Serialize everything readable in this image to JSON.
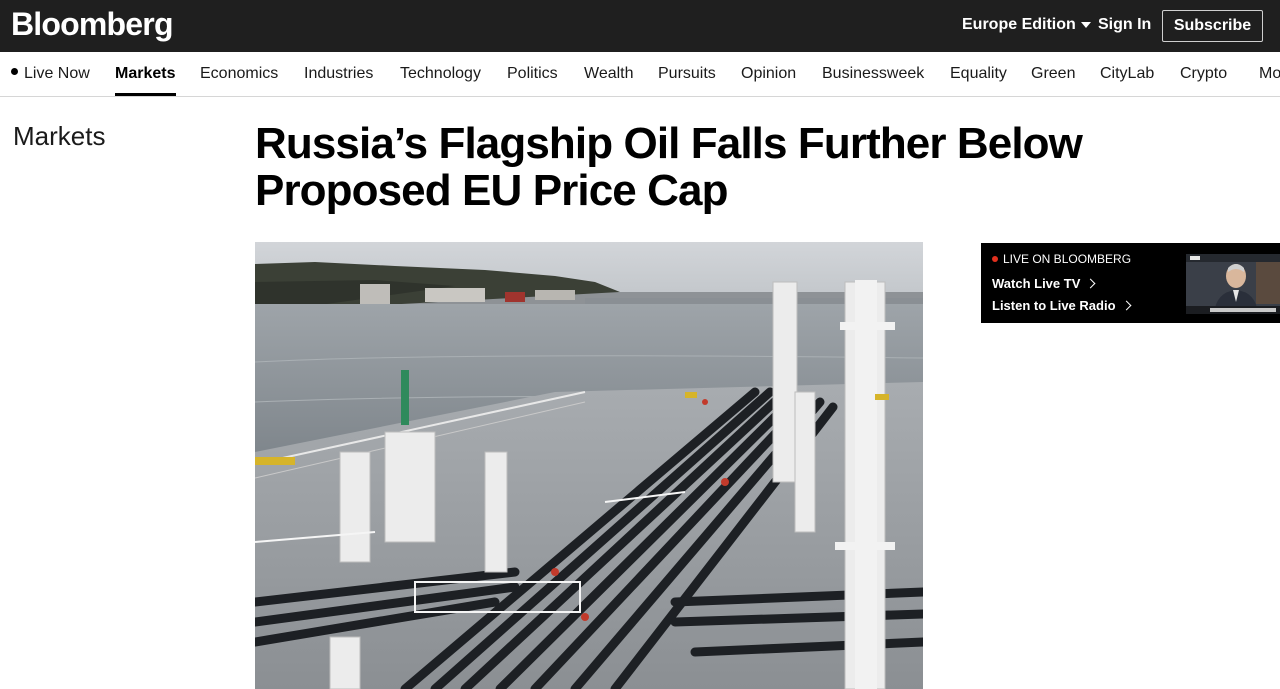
{
  "header": {
    "logo": "Bloomberg",
    "edition": "Europe Edition",
    "sign_in": "Sign In",
    "subscribe": "Subscribe"
  },
  "nav": {
    "items": [
      {
        "label": "Live Now",
        "active": false
      },
      {
        "label": "Markets",
        "active": true
      },
      {
        "label": "Economics",
        "active": false
      },
      {
        "label": "Industries",
        "active": false
      },
      {
        "label": "Technology",
        "active": false
      },
      {
        "label": "Politics",
        "active": false
      },
      {
        "label": "Wealth",
        "active": false
      },
      {
        "label": "Pursuits",
        "active": false
      },
      {
        "label": "Opinion",
        "active": false
      },
      {
        "label": "Businessweek",
        "active": false
      },
      {
        "label": "Equality",
        "active": false
      },
      {
        "label": "Green",
        "active": false
      },
      {
        "label": "CityLab",
        "active": false
      },
      {
        "label": "Crypto",
        "active": false
      },
      {
        "label": "Mo",
        "active": false
      }
    ]
  },
  "article": {
    "section": "Markets",
    "headline": "Russia’s Flagship Oil Falls Further Below Proposed EU Price Cap",
    "image_icon": "oil-tanker-deck-photo"
  },
  "live_widget": {
    "label": "LIVE ON BLOOMBERG",
    "watch": "Watch Live TV",
    "listen": "Listen to Live Radio",
    "thumb_icon": "live-tv-thumbnail"
  },
  "colors": {
    "topbar_bg": "#1f1f1f",
    "live_dot": "#e3301e",
    "widget_bg": "#000000"
  }
}
